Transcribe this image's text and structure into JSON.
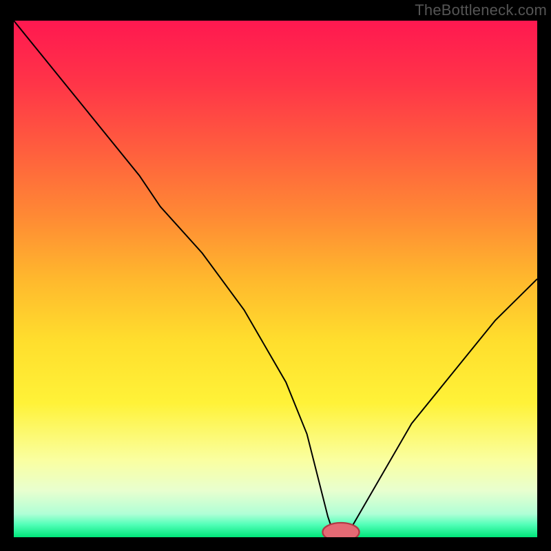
{
  "watermark": "TheBottleneck.com",
  "chart_data": {
    "type": "line",
    "title": "",
    "xlabel": "",
    "ylabel": "",
    "xlim": [
      0,
      100
    ],
    "ylim": [
      0,
      100
    ],
    "background_gradient": [
      {
        "pos": 0.0,
        "color": "#ff1850"
      },
      {
        "pos": 0.12,
        "color": "#ff3448"
      },
      {
        "pos": 0.25,
        "color": "#ff5e3e"
      },
      {
        "pos": 0.38,
        "color": "#ff8a34"
      },
      {
        "pos": 0.5,
        "color": "#ffb82d"
      },
      {
        "pos": 0.62,
        "color": "#ffde2d"
      },
      {
        "pos": 0.74,
        "color": "#fff238"
      },
      {
        "pos": 0.85,
        "color": "#faffa0"
      },
      {
        "pos": 0.91,
        "color": "#e8ffcf"
      },
      {
        "pos": 0.955,
        "color": "#b0ffd6"
      },
      {
        "pos": 0.975,
        "color": "#54ffb9"
      },
      {
        "pos": 1.0,
        "color": "#00e67a"
      }
    ],
    "series": [
      {
        "name": "bottleneck-curve",
        "stroke": "#000000",
        "x": [
          0,
          8,
          16,
          24,
          28,
          36,
          44,
          52,
          56,
          60,
          61,
          64,
          68,
          76,
          84,
          92,
          100
        ],
        "values": [
          100,
          90,
          80,
          70,
          64,
          55,
          44,
          30,
          20,
          4,
          1,
          1,
          8,
          22,
          32,
          42,
          50
        ]
      }
    ],
    "marker": {
      "name": "optimal-point",
      "x": 62.5,
      "y": 1,
      "rx": 3.5,
      "ry": 1.8,
      "fill": "#e46a74",
      "stroke": "#b03a45"
    }
  }
}
